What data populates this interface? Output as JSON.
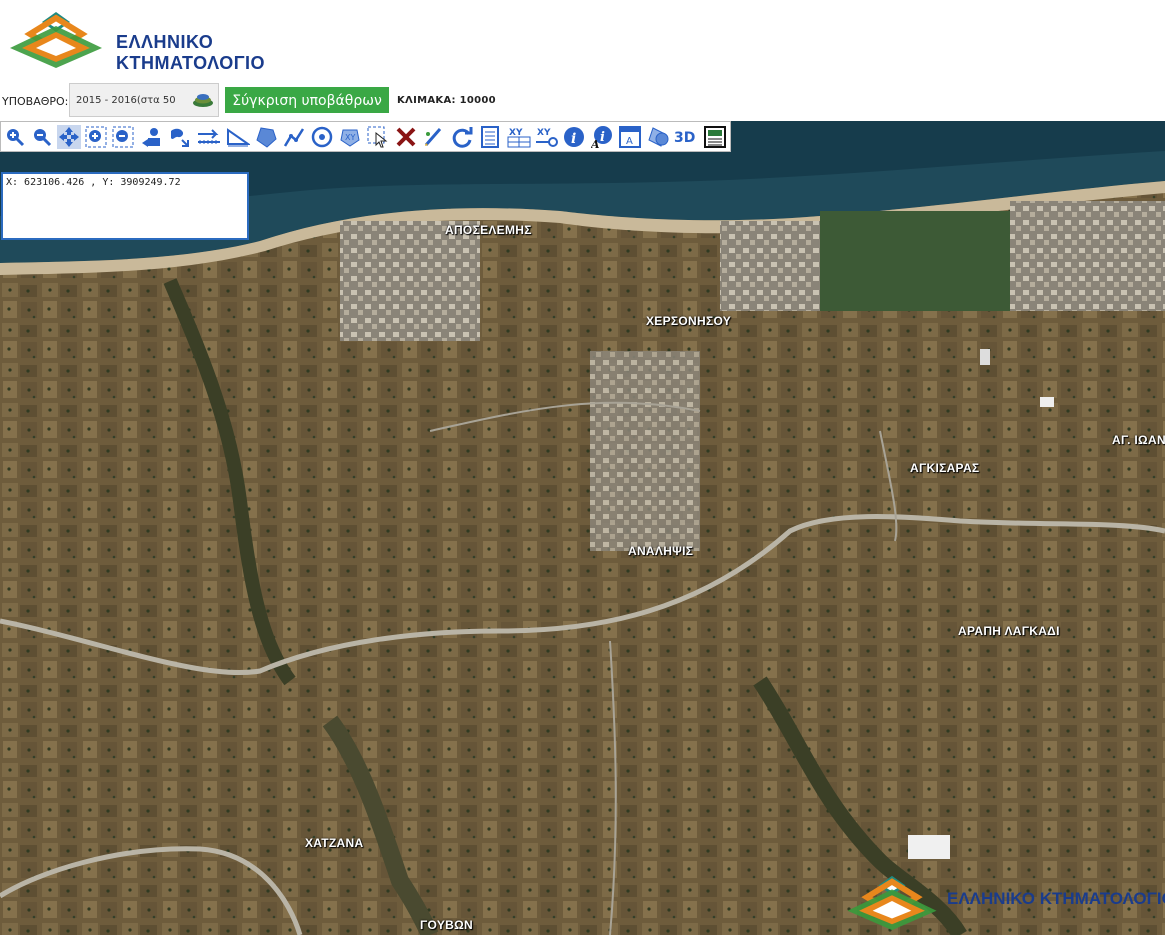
{
  "header": {
    "logo_text": "ΕΛΛΗΝΙΚΟ ΚΤΗΜΑΤΟΛΟΓΙΟ",
    "logo_colors": {
      "orange": "#e8871c",
      "green": "#3a9a3c",
      "teal": "#1f8a80",
      "blue": "#1a3c8c"
    }
  },
  "basemap": {
    "label": "ΥΠΟΒΑΘΡΟ:",
    "selected": "2015 - 2016(στα 50 ",
    "compare_button": "Σύγκριση υποβάθρων",
    "scale_label": "ΚΛΙΜΑΚΑ: 10000"
  },
  "toolbar": {
    "tools": [
      {
        "icon": "zoom-in-icon"
      },
      {
        "icon": "zoom-out-icon"
      },
      {
        "icon": "pan-icon"
      },
      {
        "icon": "zoom-box-in-icon"
      },
      {
        "icon": "zoom-box-out-icon"
      },
      {
        "icon": "previous-extent-icon"
      },
      {
        "icon": "full-extent-icon"
      },
      {
        "icon": "measure-distance-icon"
      },
      {
        "icon": "measure-angle-icon"
      },
      {
        "icon": "measure-area-icon"
      },
      {
        "icon": "draw-line-icon"
      },
      {
        "icon": "draw-circle-icon"
      },
      {
        "icon": "draw-polygon-icon"
      },
      {
        "icon": "select-icon"
      },
      {
        "icon": "clear-icon"
      },
      {
        "icon": "edit-icon"
      },
      {
        "icon": "refresh-icon"
      },
      {
        "icon": "legend-icon"
      },
      {
        "icon": "xy-table-icon",
        "text": "XY"
      },
      {
        "icon": "xy-goto-icon",
        "text": "XY"
      },
      {
        "icon": "info-icon",
        "text": "i"
      },
      {
        "icon": "info-text-icon",
        "text": "i"
      },
      {
        "icon": "label-icon",
        "text": "A"
      },
      {
        "icon": "layers-icon"
      },
      {
        "icon": "3d-icon",
        "text": "3D"
      },
      {
        "icon": "print-icon"
      }
    ]
  },
  "coordinates": {
    "text": "X: 623106.426 , Y: 3909249.72"
  },
  "map_labels": {
    "aposelemis": "ΑΠΟΣΕΛΕΜΗΣ",
    "chersonisou": "ΧΕΡΣΟΝΗΣΟΥ",
    "ag_ioannis": "ΑΓ. ΙΩΑΝ",
    "agkisaras": "ΑΓΚΙΣΑΡΑΣ",
    "analipsis": "ΑΝΑΛΗΨΙΣ",
    "arapi_lagkadi": "ΑΡΑΠΗ ΛΑΓΚΑΔΙ",
    "chatzana": "ΧΑΤΖΑΝΑ",
    "gouvon": "ΓΟΥΒΩΝ"
  },
  "watermark": {
    "text": "ΕΛΛΗΝΙΚΟ ΚΤΗΜΑΤΟΛΟΓΙΟ"
  }
}
